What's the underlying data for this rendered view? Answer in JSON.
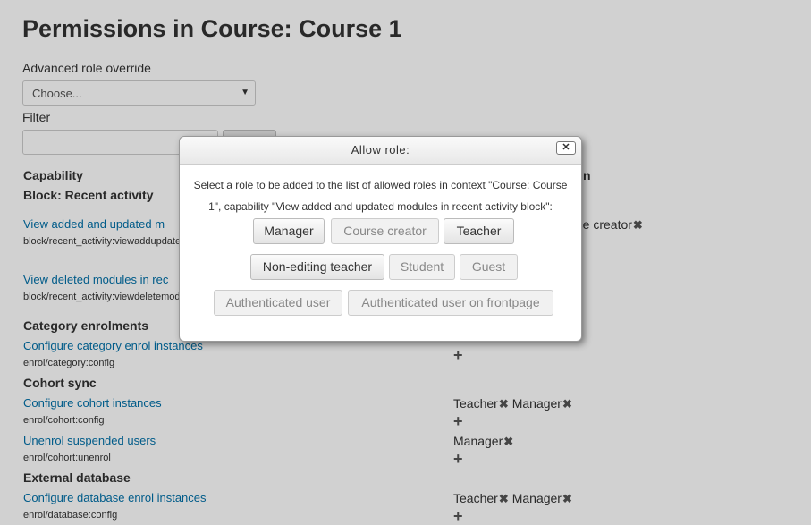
{
  "page": {
    "title": "Permissions in Course: Course 1",
    "advanced_label": "Advanced role override",
    "select_placeholder": "Choose...",
    "filter_label": "Filter"
  },
  "table": {
    "col_capability": "Capability",
    "col_roles_suffix": "n",
    "sections": [
      {
        "name": "Block: Recent activity",
        "rows": [
          {
            "link": "View added and updated m",
            "cap": "block/recent_activity:viewaddupdate",
            "roles": [
              "Course creator"
            ],
            "roles_prefix": "rse creator"
          },
          {
            "link": "View deleted modules in rec",
            "cap": "block/recent_activity:viewdeletemod",
            "roles": []
          }
        ]
      },
      {
        "name": "Category enrolments",
        "rows": [
          {
            "link": "Configure category enrol instances",
            "cap": "enrol/category:config",
            "roles": []
          }
        ]
      },
      {
        "name": "Cohort sync",
        "rows": [
          {
            "link": "Configure cohort instances",
            "cap": "enrol/cohort:config",
            "roles": [
              "Teacher",
              "Manager"
            ]
          },
          {
            "link": "Unenrol suspended users",
            "cap": "enrol/cohort:unenrol",
            "roles": [
              "Manager"
            ]
          }
        ]
      },
      {
        "name": "External database",
        "rows": [
          {
            "link": "Configure database enrol instances",
            "cap": "enrol/database:config",
            "roles": [
              "Teacher",
              "Manager"
            ]
          }
        ]
      }
    ]
  },
  "dialog": {
    "title": "Allow role:",
    "close": "✕",
    "message": "Select a role to be added to the list of allowed roles in context \"Course: Course 1\", capability \"View added and updated modules in recent activity block\":",
    "buttons": {
      "manager": "Manager",
      "course_creator": "Course creator",
      "teacher": "Teacher",
      "non_editing_teacher": "Non-editing teacher",
      "student": "Student",
      "guest": "Guest",
      "authenticated_user": "Authenticated user",
      "authenticated_frontpage": "Authenticated user on frontpage"
    }
  },
  "icons": {
    "remove": "✖",
    "add": "+"
  }
}
